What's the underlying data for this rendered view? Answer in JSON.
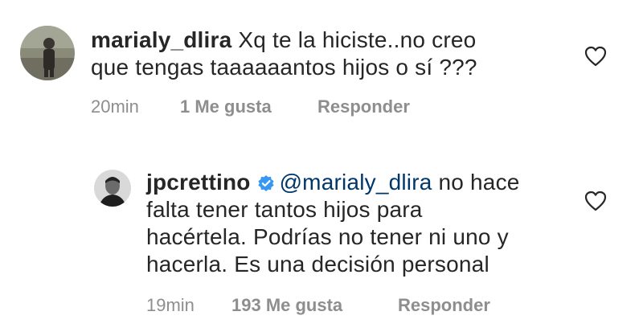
{
  "comment1": {
    "username": "marialy_dlira",
    "text_line1": "Xq te la hiciste..no creo",
    "text_line2": "que tengas taaaaaantos hijos o sí ???",
    "time": "20min",
    "likes": "1 Me gusta",
    "reply": "Responder"
  },
  "comment2": {
    "username": "jpcrettino",
    "mention": "@marialy_dlira",
    "text_line1": " no hace",
    "text_line2": "falta tener tantos hijos para",
    "text_line3": "hacértela. Podrías no tener ni uno y",
    "text_line4": "hacerla. Es una decisión personal",
    "time": "19min",
    "likes": "193 Me gusta",
    "reply": "Responder"
  },
  "colors": {
    "text": "#262626",
    "secondary": "#8e8e8e",
    "mention": "#00376b",
    "verified": "#3897f0"
  },
  "icons": {
    "like": "heart-outline-icon",
    "verified": "verified-badge-icon"
  }
}
